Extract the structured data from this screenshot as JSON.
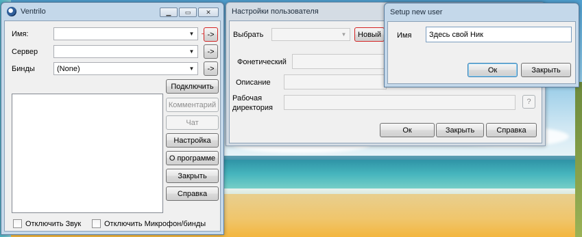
{
  "ventrilo": {
    "title": "Ventrilo",
    "labels": {
      "name": "Имя:",
      "server": "Сервер",
      "binds": "Бинды"
    },
    "binds_value": "(None)",
    "arrow_btn": "->",
    "buttons": {
      "connect": "Подключить",
      "comment": "Комментарий",
      "chat": "Чат",
      "settings": "Настройка",
      "about": "О программе",
      "close": "Закрыть",
      "help": "Справка"
    },
    "checkboxes": {
      "mute_sound": "Отключить Звук",
      "mute_mic": "Отключить Микрофон/бинды"
    }
  },
  "user_settings": {
    "title": "Настройки пользователя",
    "choose_label": "Выбрать",
    "new_button": "Новый",
    "phonetic_label": "Фонетический",
    "description_label": "Описание",
    "workdir_label_1": "Рабочая",
    "workdir_label_2": "директория",
    "help_icon": "?",
    "buttons": {
      "ok": "Ок",
      "close": "Закрыть",
      "help": "Справка"
    }
  },
  "setup_user": {
    "title": "Setup new user",
    "name_label": "Имя",
    "name_value": "Здесь свой Ник",
    "buttons": {
      "ok": "Ок",
      "close": "Закрыть"
    }
  },
  "colors": {
    "annotation_red": "#d32020"
  }
}
